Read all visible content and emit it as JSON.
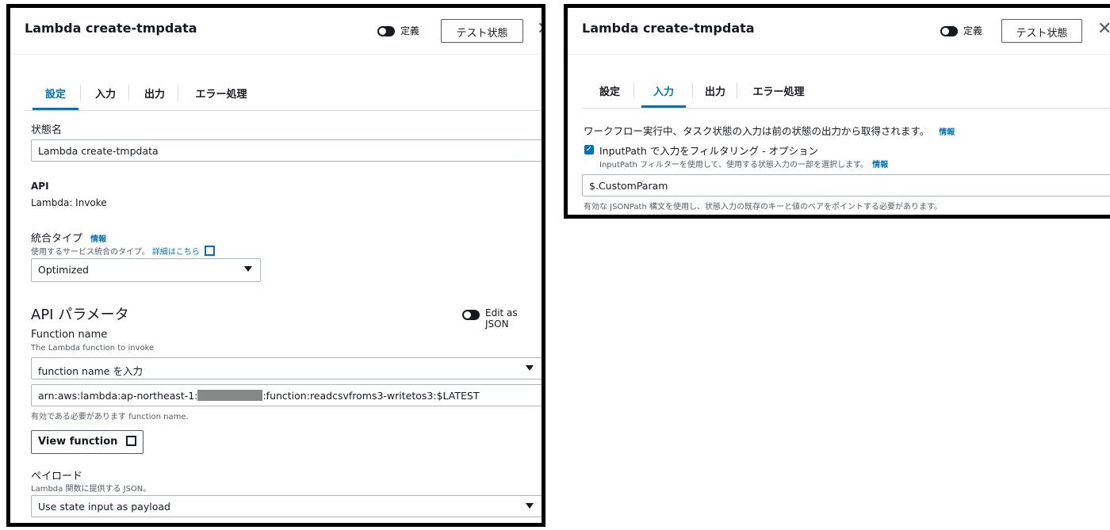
{
  "left": {
    "title": "Lambda create-tmpdata",
    "definition_label": "定義",
    "test_state_button": "テスト状態",
    "close_glyph": "✕",
    "tabs": [
      "設定",
      "入力",
      "出力",
      "エラー処理"
    ],
    "active_tab": "設定",
    "state_name_label": "状態名",
    "state_name_value": "Lambda create-tmpdata",
    "api_label": "API",
    "api_value": "Lambda: Invoke",
    "integration_label": "統合タイプ",
    "info_link": "情報",
    "integration_desc": "使用するサービス統合のタイプ。",
    "learn_more_link": "詳細はこちら",
    "integration_value": "Optimized",
    "api_params_heading": "API パラメータ",
    "edit_json_label": "Edit as JSON",
    "function_name_label": "Function name",
    "function_name_desc": "The Lambda function to invoke",
    "function_name_placeholder": "function name を入力",
    "arn_prefix": "arn:aws:lambda:ap-northeast-1:",
    "arn_suffix": ":function:readcsvfroms3-writetos3:$LATEST",
    "function_name_hint": "有効である必要があります function name.",
    "view_function_button": "View function",
    "payload_label": "ペイロード",
    "payload_desc": "Lambda 関数に提供する JSON。",
    "payload_value": "Use state input as payload"
  },
  "right": {
    "title": "Lambda create-tmpdata",
    "definition_label": "定義",
    "test_state_button": "テスト状態",
    "close_glyph": "✕",
    "tabs": [
      "設定",
      "入力",
      "出力",
      "エラー処理"
    ],
    "active_tab": "入力",
    "input_desc": "ワークフロー実行中、タスク状態の入力は前の状態の出力から取得されます。",
    "info_link": "情報",
    "inputpath_label": "InputPath で入力をフィルタリング - オプション",
    "inputpath_checked": true,
    "inputpath_desc": "InputPath フィルターを使用して、使用する状態入力の一部を選択します。",
    "inputpath_value": "$.CustomParam",
    "inputpath_hint": "有効な JSONPath 構文を使用し、状態入力の既存のキーと値のペアをポイントする必要があります。"
  },
  "colors": {
    "accent": "#0073bb",
    "text": "#16191f",
    "muted": "#545b64",
    "border": "#aab7b8"
  },
  "icons": [
    "toggle-icon",
    "close-icon",
    "external-link-icon",
    "dropdown-caret-icon",
    "checkbox-icon"
  ]
}
